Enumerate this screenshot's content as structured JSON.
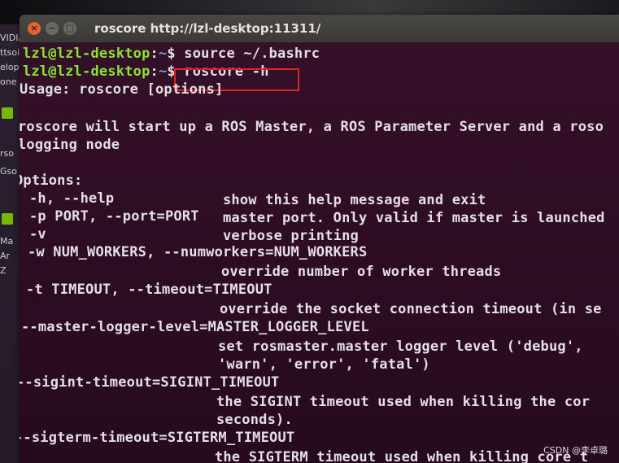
{
  "window": {
    "title": "roscore http://lzl-desktop:11311/",
    "close_glyph": "×",
    "min_glyph": "−",
    "max_glyph": "□"
  },
  "launcher": [
    "VIDIA",
    "ttsoi",
    "elop",
    "one",
    "",
    "rso",
    "Gso",
    "",
    "Ma",
    "Ar",
    "Z"
  ],
  "terminal": {
    "line1": {
      "user": "lzl@lzl-desktop",
      "sep": ":",
      "path": "~",
      "cmd": "$ source ~/.bashrc"
    },
    "line2": {
      "user": "lzl@lzl-desktop",
      "sep": ":",
      "path": "~",
      "cmd": "$ roscore -h"
    },
    "usage": "Usage: roscore [options]",
    "desc1": "roscore will start up a ROS Master, a ROS Parameter Server and a roso",
    "desc2": "logging node",
    "options_header": "Options:",
    "opt_h": "-h, --help",
    "opt_h_desc": "show this help message and exit",
    "opt_p": "-p PORT, --port=PORT",
    "opt_p_desc": "master port. Only valid if master is launched",
    "opt_v": "-v",
    "opt_v_desc": "verbose printing",
    "opt_w": "-w NUM_WORKERS, --numworkers=NUM_WORKERS",
    "opt_w_desc": "override number of worker threads",
    "opt_t": "-t TIMEOUT, --timeout=TIMEOUT",
    "opt_t_desc": "override the socket connection timeout (in se",
    "opt_mll": "--master-logger-level=MASTER_LOGGER_LEVEL",
    "opt_mll_desc1": "set rosmaster.master logger level ('debug',",
    "opt_mll_desc2": "'warn', 'error', 'fatal')",
    "opt_sigint": "--sigint-timeout=SIGINT_TIMEOUT",
    "opt_sigint_desc1": "the SIGINT timeout used when killing the cor",
    "opt_sigint_desc2": "seconds).",
    "opt_sigterm": "--sigterm-timeout=SIGTERM_TIMEOUT",
    "opt_sigterm_desc1": "the SIGTERM timeout used when killing core t"
  },
  "watermark": "CSDN @李卓璐",
  "colors": {
    "prompt_user": "#8ae234",
    "prompt_path": "#729fcf",
    "highlight": "#e02424"
  }
}
